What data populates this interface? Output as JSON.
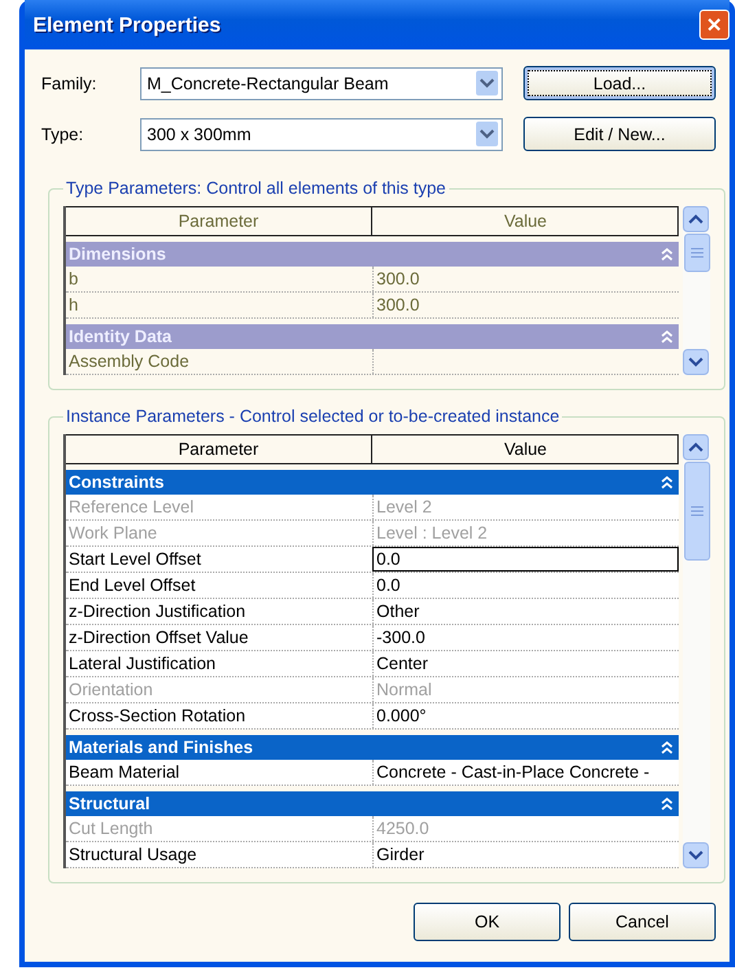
{
  "window": {
    "title": "Element Properties",
    "close": "✕"
  },
  "fields": [
    {
      "label": "Family:",
      "value": "M_Concrete-Rectangular Beam",
      "button": "Load...",
      "focused": true
    },
    {
      "label": "Type:",
      "value": "300 x 300mm",
      "button": "Edit / New...",
      "focused": false
    }
  ],
  "type_parameters": {
    "title": "Type Parameters: Control all elements of this type",
    "disabled": true,
    "columns": [
      "Parameter",
      "Value"
    ],
    "rows": [
      {
        "kind": "group",
        "name": "Dimensions"
      },
      {
        "kind": "param",
        "name": "b",
        "value": "300.0"
      },
      {
        "kind": "param",
        "name": "h",
        "value": "300.0"
      },
      {
        "kind": "group",
        "name": "Identity Data"
      },
      {
        "kind": "param",
        "name": "Assembly Code",
        "value": ""
      }
    ]
  },
  "instance_parameters": {
    "title": "Instance Parameters - Control selected or to-be-created instance",
    "disabled": false,
    "columns": [
      "Parameter",
      "Value"
    ],
    "rows": [
      {
        "kind": "group",
        "name": "Constraints"
      },
      {
        "kind": "param",
        "name": "Reference Level",
        "value": "Level 2",
        "disabled": true,
        "focused": false
      },
      {
        "kind": "param",
        "name": "Work Plane",
        "value": "Level : Level 2",
        "disabled": true,
        "focused": false
      },
      {
        "kind": "param",
        "name": "Start Level Offset",
        "value": "0.0",
        "disabled": false,
        "focused": true
      },
      {
        "kind": "param",
        "name": "End Level Offset",
        "value": "0.0",
        "disabled": false,
        "focused": false
      },
      {
        "kind": "param",
        "name": "z-Direction Justification",
        "value": "Other",
        "disabled": false,
        "focused": false
      },
      {
        "kind": "param",
        "name": "z-Direction Offset Value",
        "value": "-300.0",
        "disabled": false,
        "focused": false
      },
      {
        "kind": "param",
        "name": "Lateral Justification",
        "value": "Center",
        "disabled": false,
        "focused": false
      },
      {
        "kind": "param",
        "name": "Orientation",
        "value": "Normal",
        "disabled": true,
        "focused": false
      },
      {
        "kind": "param",
        "name": "Cross-Section Rotation",
        "value": "0.000°",
        "disabled": false,
        "focused": false
      },
      {
        "kind": "group",
        "name": "Materials and Finishes"
      },
      {
        "kind": "param",
        "name": "Beam Material",
        "value": "Concrete - Cast-in-Place Concrete -",
        "disabled": false,
        "focused": false
      },
      {
        "kind": "group",
        "name": "Structural"
      },
      {
        "kind": "param",
        "name": "Cut Length",
        "value": "4250.0",
        "disabled": true,
        "focused": false
      },
      {
        "kind": "param",
        "name": "Structural Usage",
        "value": "Girder",
        "disabled": false,
        "focused": false
      }
    ]
  },
  "buttons": [
    "OK",
    "Cancel"
  ]
}
